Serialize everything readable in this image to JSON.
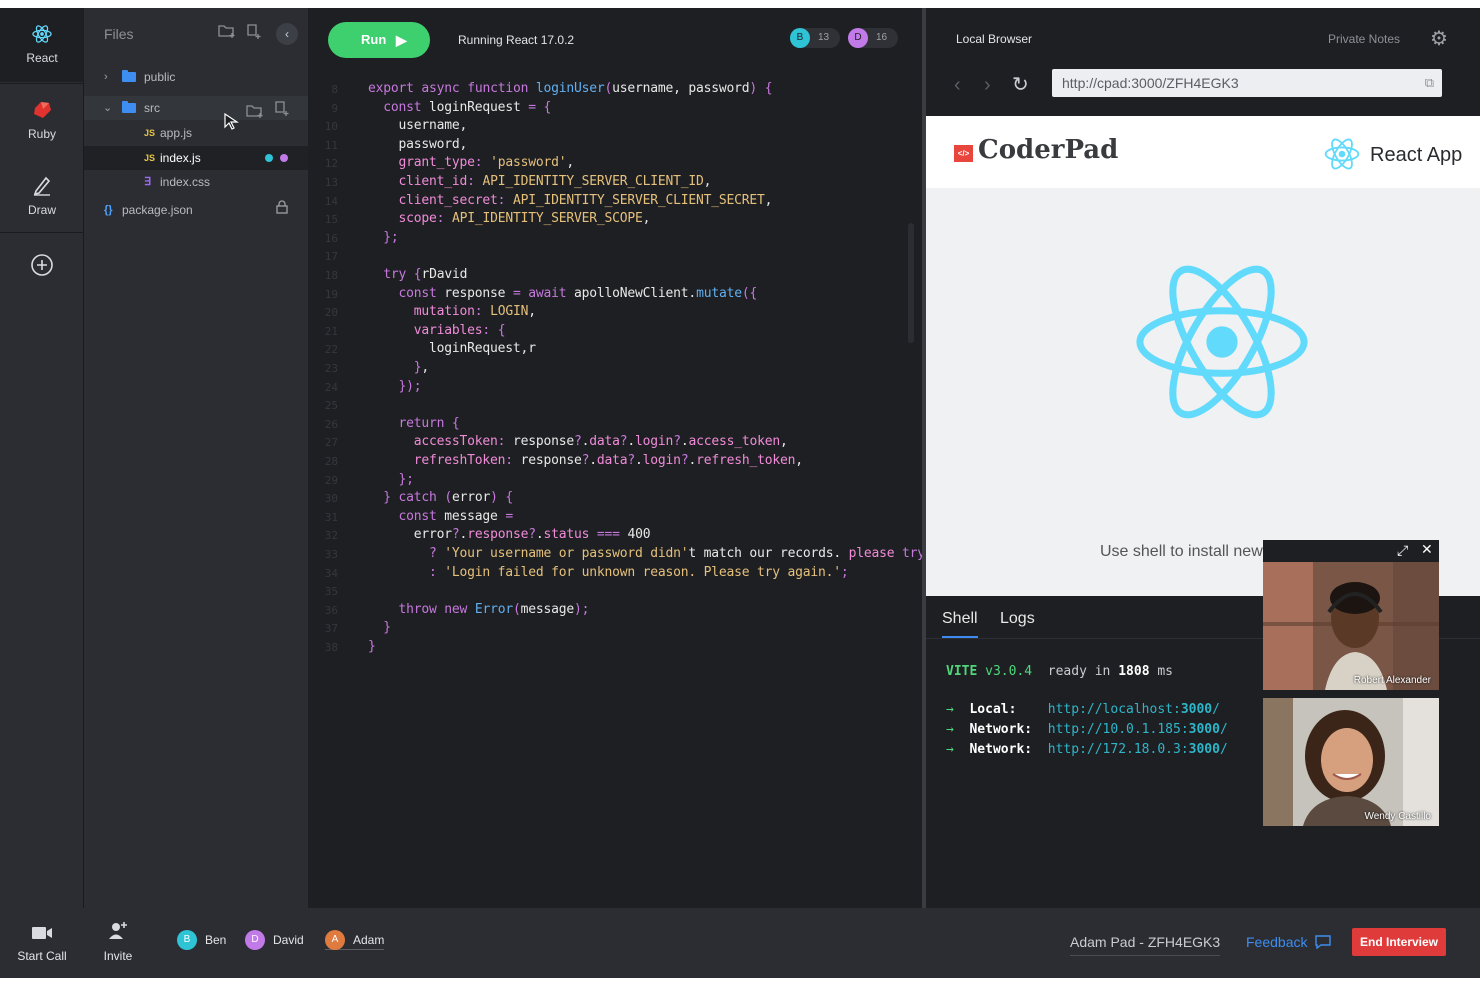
{
  "rail": {
    "items": [
      {
        "label": "React",
        "icon": "react-icon"
      },
      {
        "label": "Ruby",
        "icon": "ruby-icon"
      },
      {
        "label": "Draw",
        "icon": "pencil-icon"
      }
    ],
    "add_icon": "plus-circle-icon"
  },
  "files": {
    "title": "Files",
    "tree": [
      {
        "name": "public",
        "type": "folder"
      },
      {
        "name": "src",
        "type": "folder"
      },
      {
        "name": "app.js",
        "type": "js",
        "badge": "JS"
      },
      {
        "name": "index.js",
        "type": "js",
        "badge": "JS"
      },
      {
        "name": "index.css",
        "type": "css",
        "badge": "∃"
      },
      {
        "name": "package.json",
        "type": "json",
        "badge": "{}"
      }
    ]
  },
  "editor": {
    "run_label": "Run",
    "status": "Running React 17.0.2",
    "presence": [
      {
        "initial": "B",
        "count": "13",
        "color": "#2ec4d6"
      },
      {
        "initial": "D",
        "count": "16",
        "color": "#c27ae8"
      }
    ],
    "lines": [
      {
        "n": "8",
        "text": "export async function loginUser(username, password) {"
      },
      {
        "n": "9",
        "text": "  const loginRequest = {"
      },
      {
        "n": "10",
        "text": "    username,"
      },
      {
        "n": "11",
        "text": "    password,"
      },
      {
        "n": "12",
        "text": "    grant_type: 'password',"
      },
      {
        "n": "13",
        "text": "    client_id: API_IDENTITY_SERVER_CLIENT_ID,"
      },
      {
        "n": "14",
        "text": "    client_secret: API_IDENTITY_SERVER_CLIENT_SECRET,"
      },
      {
        "n": "15",
        "text": "    scope: API_IDENTITY_SERVER_SCOPE,"
      },
      {
        "n": "16",
        "text": "  };"
      },
      {
        "n": "17",
        "text": ""
      },
      {
        "n": "18",
        "text": "  try {rDavid"
      },
      {
        "n": "19",
        "text": "    const response = await apolloNewClient.mutate({"
      },
      {
        "n": "20",
        "text": "      mutation: LOGIN,"
      },
      {
        "n": "21",
        "text": "      variables: {"
      },
      {
        "n": "22",
        "text": "        loginRequest,r"
      },
      {
        "n": "23",
        "text": "      },"
      },
      {
        "n": "24",
        "text": "    });"
      },
      {
        "n": "25",
        "text": ""
      },
      {
        "n": "26",
        "text": "    return {"
      },
      {
        "n": "27",
        "text": "      accessToken: response?.data?.login?.access_token,"
      },
      {
        "n": "28",
        "text": "      refreshToken: response?.data?.login?.refresh_token,"
      },
      {
        "n": "29",
        "text": "    };"
      },
      {
        "n": "30",
        "text": "  } catch (error) {"
      },
      {
        "n": "31",
        "text": "    const message ="
      },
      {
        "n": "32",
        "text": "      error?.response?.status === 400"
      },
      {
        "n": "33",
        "text": "        ? 'Your username or password didn't match our records. please try again.'"
      },
      {
        "n": "34",
        "text": "        : 'Login failed for unknown reason. Please try again.';"
      },
      {
        "n": "35",
        "text": ""
      },
      {
        "n": "36",
        "text": "    throw new Error(message);"
      },
      {
        "n": "37",
        "text": "  }"
      },
      {
        "n": "38",
        "text": "}"
      }
    ]
  },
  "browser": {
    "title": "Local Browser",
    "private_notes": "Private Notes",
    "url": "http://cpad:3000/ZFH4EGK3",
    "logo_badge": "</>",
    "logo_text": "CoderPad",
    "app_title": "React App",
    "install_note": "Use shell to install new",
    "react_color": "#61dafb"
  },
  "terminal": {
    "tabs": [
      "Shell",
      "Logs"
    ],
    "vite": "VITE",
    "version": "v3.0.4",
    "ready_pre": "ready in",
    "ready_ms": "1808",
    "ready_unit": "ms",
    "rows": [
      {
        "label": "Local:",
        "host": "http://localhost:",
        "port": "3000",
        "slash": "/"
      },
      {
        "label": "Network:",
        "host": "http://10.0.1.185:",
        "port": "3000",
        "slash": "/"
      },
      {
        "label": "Network:",
        "host": "http://172.18.0.3:",
        "port": "3000",
        "slash": "/"
      }
    ]
  },
  "video": {
    "participants": [
      {
        "name": "Robert Alexander"
      },
      {
        "name": "Wendy Castillo"
      }
    ]
  },
  "bottom": {
    "start_call": "Start Call",
    "invite": "Invite",
    "people": [
      {
        "initial": "B",
        "name": "Ben",
        "color": "#2ec4d6"
      },
      {
        "initial": "D",
        "name": "David",
        "color": "#c27ae8"
      },
      {
        "initial": "A",
        "name": "Adam",
        "color": "#e07b3f"
      }
    ],
    "pad_name": "Adam Pad - ZFH4EGK3",
    "feedback": "Feedback",
    "end_interview": "End Interview"
  }
}
